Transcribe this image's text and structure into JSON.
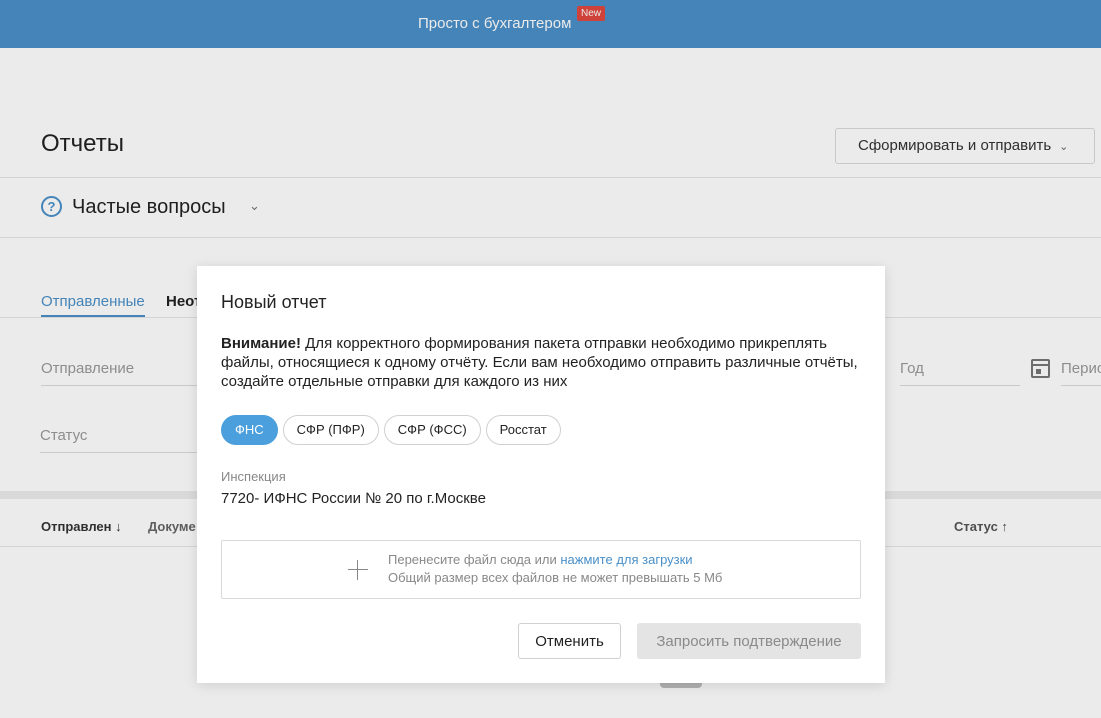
{
  "topbar": {
    "promo_text": "Просто с бухгалтером",
    "new_badge": "New"
  },
  "page": {
    "title": "Отчеты",
    "form_send_button": "Сформировать и отправить",
    "faq_title": "Частые вопросы",
    "tabs": [
      {
        "label": "Отправленные",
        "active": true
      },
      {
        "label": "Неот"
      }
    ],
    "filters": {
      "dispatch_placeholder": "Отправление",
      "status_placeholder": "Статус",
      "year_placeholder": "Год",
      "period_placeholder": "Перио"
    },
    "table_headers": {
      "sent": "Отправлен ↓",
      "document": "Докуме",
      "status": "Статус ↑"
    }
  },
  "modal": {
    "title": "Новый отчет",
    "warning_bold": "Внимание!",
    "warning_text": " Для корректного формирования пакета отправки необходимо прикреплять файлы, относящиеся к одному отчёту. Если вам необходимо отправить различные отчёты, создайте отдельные отправки для каждого из них",
    "chips": [
      {
        "label": "ФНС",
        "active": true
      },
      {
        "label": "СФР (ПФР)",
        "active": false
      },
      {
        "label": "СФР (ФСС)",
        "active": false
      },
      {
        "label": "Росстат",
        "active": false
      }
    ],
    "inspection_label": "Инспекция",
    "inspection_value": "7720- ИФНС России № 20 по г.Москве",
    "dropzone": {
      "text_before_link": "Перенесите файл сюда или ",
      "link_text": "нажмите для загрузки",
      "size_note": "Общий размер всех файлов не может превышать 5 Мб"
    },
    "cancel_button": "Отменить",
    "confirm_button": "Запросить подтверждение"
  },
  "colors": {
    "topbar": "#4a90c8",
    "accent": "#4a9fdc",
    "badge": "#e0483e"
  }
}
